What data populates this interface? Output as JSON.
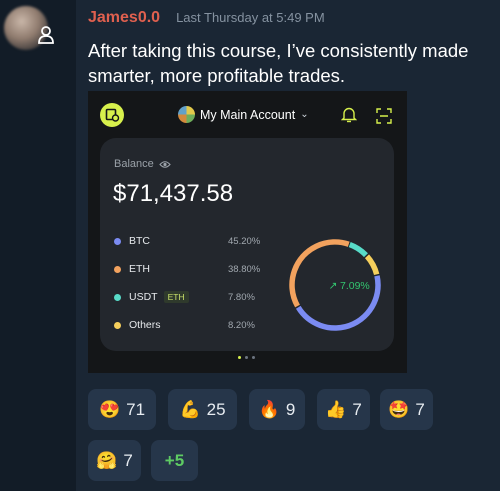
{
  "message": {
    "username": "James0.0",
    "timestamp": "Last Thursday at 5:49 PM",
    "text": "After taking this course, I’ve consistently made smarter, more profitable trades."
  },
  "screenshot": {
    "account_name": "My Main Account",
    "balance_label": "Balance",
    "balance_value": "$71,437.58",
    "assets": [
      {
        "name": "BTC",
        "percent": "45.20%",
        "color": "#7b8bf2",
        "fraction": 0.452
      },
      {
        "name": "ETH",
        "percent": "38.80%",
        "color": "#f2a25e",
        "fraction": 0.388
      },
      {
        "name": "USDT",
        "tag": "ETH",
        "percent": "7.80%",
        "color": "#58dbc8",
        "fraction": 0.078
      },
      {
        "name": "Others",
        "percent": "8.20%",
        "color": "#f5cf5c",
        "fraction": 0.082
      }
    ],
    "change": "7.09%",
    "change_color": "#33c46f",
    "accent": "#d7f04c"
  },
  "reactions": [
    {
      "emoji": "😍",
      "count": "71"
    },
    {
      "emoji": "💪",
      "count": "25"
    },
    {
      "emoji": "🔥",
      "count": "9"
    },
    {
      "emoji": "👍",
      "count": "7"
    },
    {
      "emoji": "🤩",
      "count": "7"
    },
    {
      "emoji": "🤗",
      "count": "7"
    },
    {
      "more_label": "+5"
    }
  ]
}
